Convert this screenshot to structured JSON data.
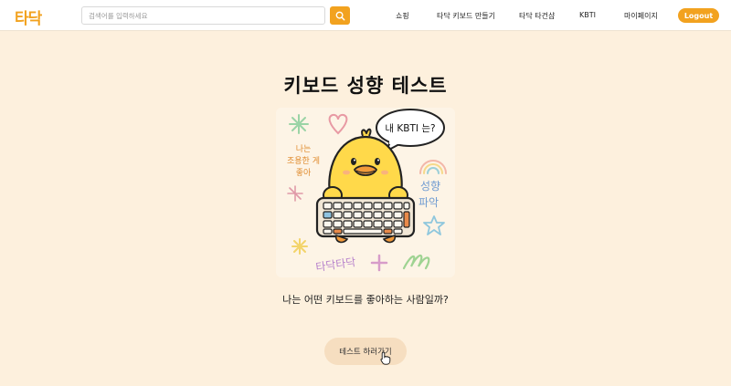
{
  "header": {
    "logo": "타닥",
    "search": {
      "placeholder": "검색어를 입력하세요",
      "value": ""
    },
    "search_icon": "search-icon",
    "nav": [
      {
        "label": "쇼핑"
      },
      {
        "label": "타닥 키보드 만들기"
      },
      {
        "label": "타닥 타건샵"
      },
      {
        "label": "KBTI"
      },
      {
        "label": "마이페이지"
      }
    ],
    "logout_label": "Logout"
  },
  "main": {
    "title": "키보드 성향 테스트",
    "illustration": {
      "speech_bubble": "내 KBTI 는?",
      "left_text": [
        "나는",
        "조용한 게",
        "좋아"
      ],
      "right_text": [
        "성향",
        "파악"
      ],
      "bottom_text": "타닥타닥"
    },
    "question": "나는 어떤 키보드를 좋아하는 사람일까?",
    "start_button_label": "테스트 하러가기"
  },
  "colors": {
    "accent": "#f2a21f",
    "background": "#fdf0dd",
    "button_bg": "#f6dec0",
    "duck": "#ffd94a"
  }
}
